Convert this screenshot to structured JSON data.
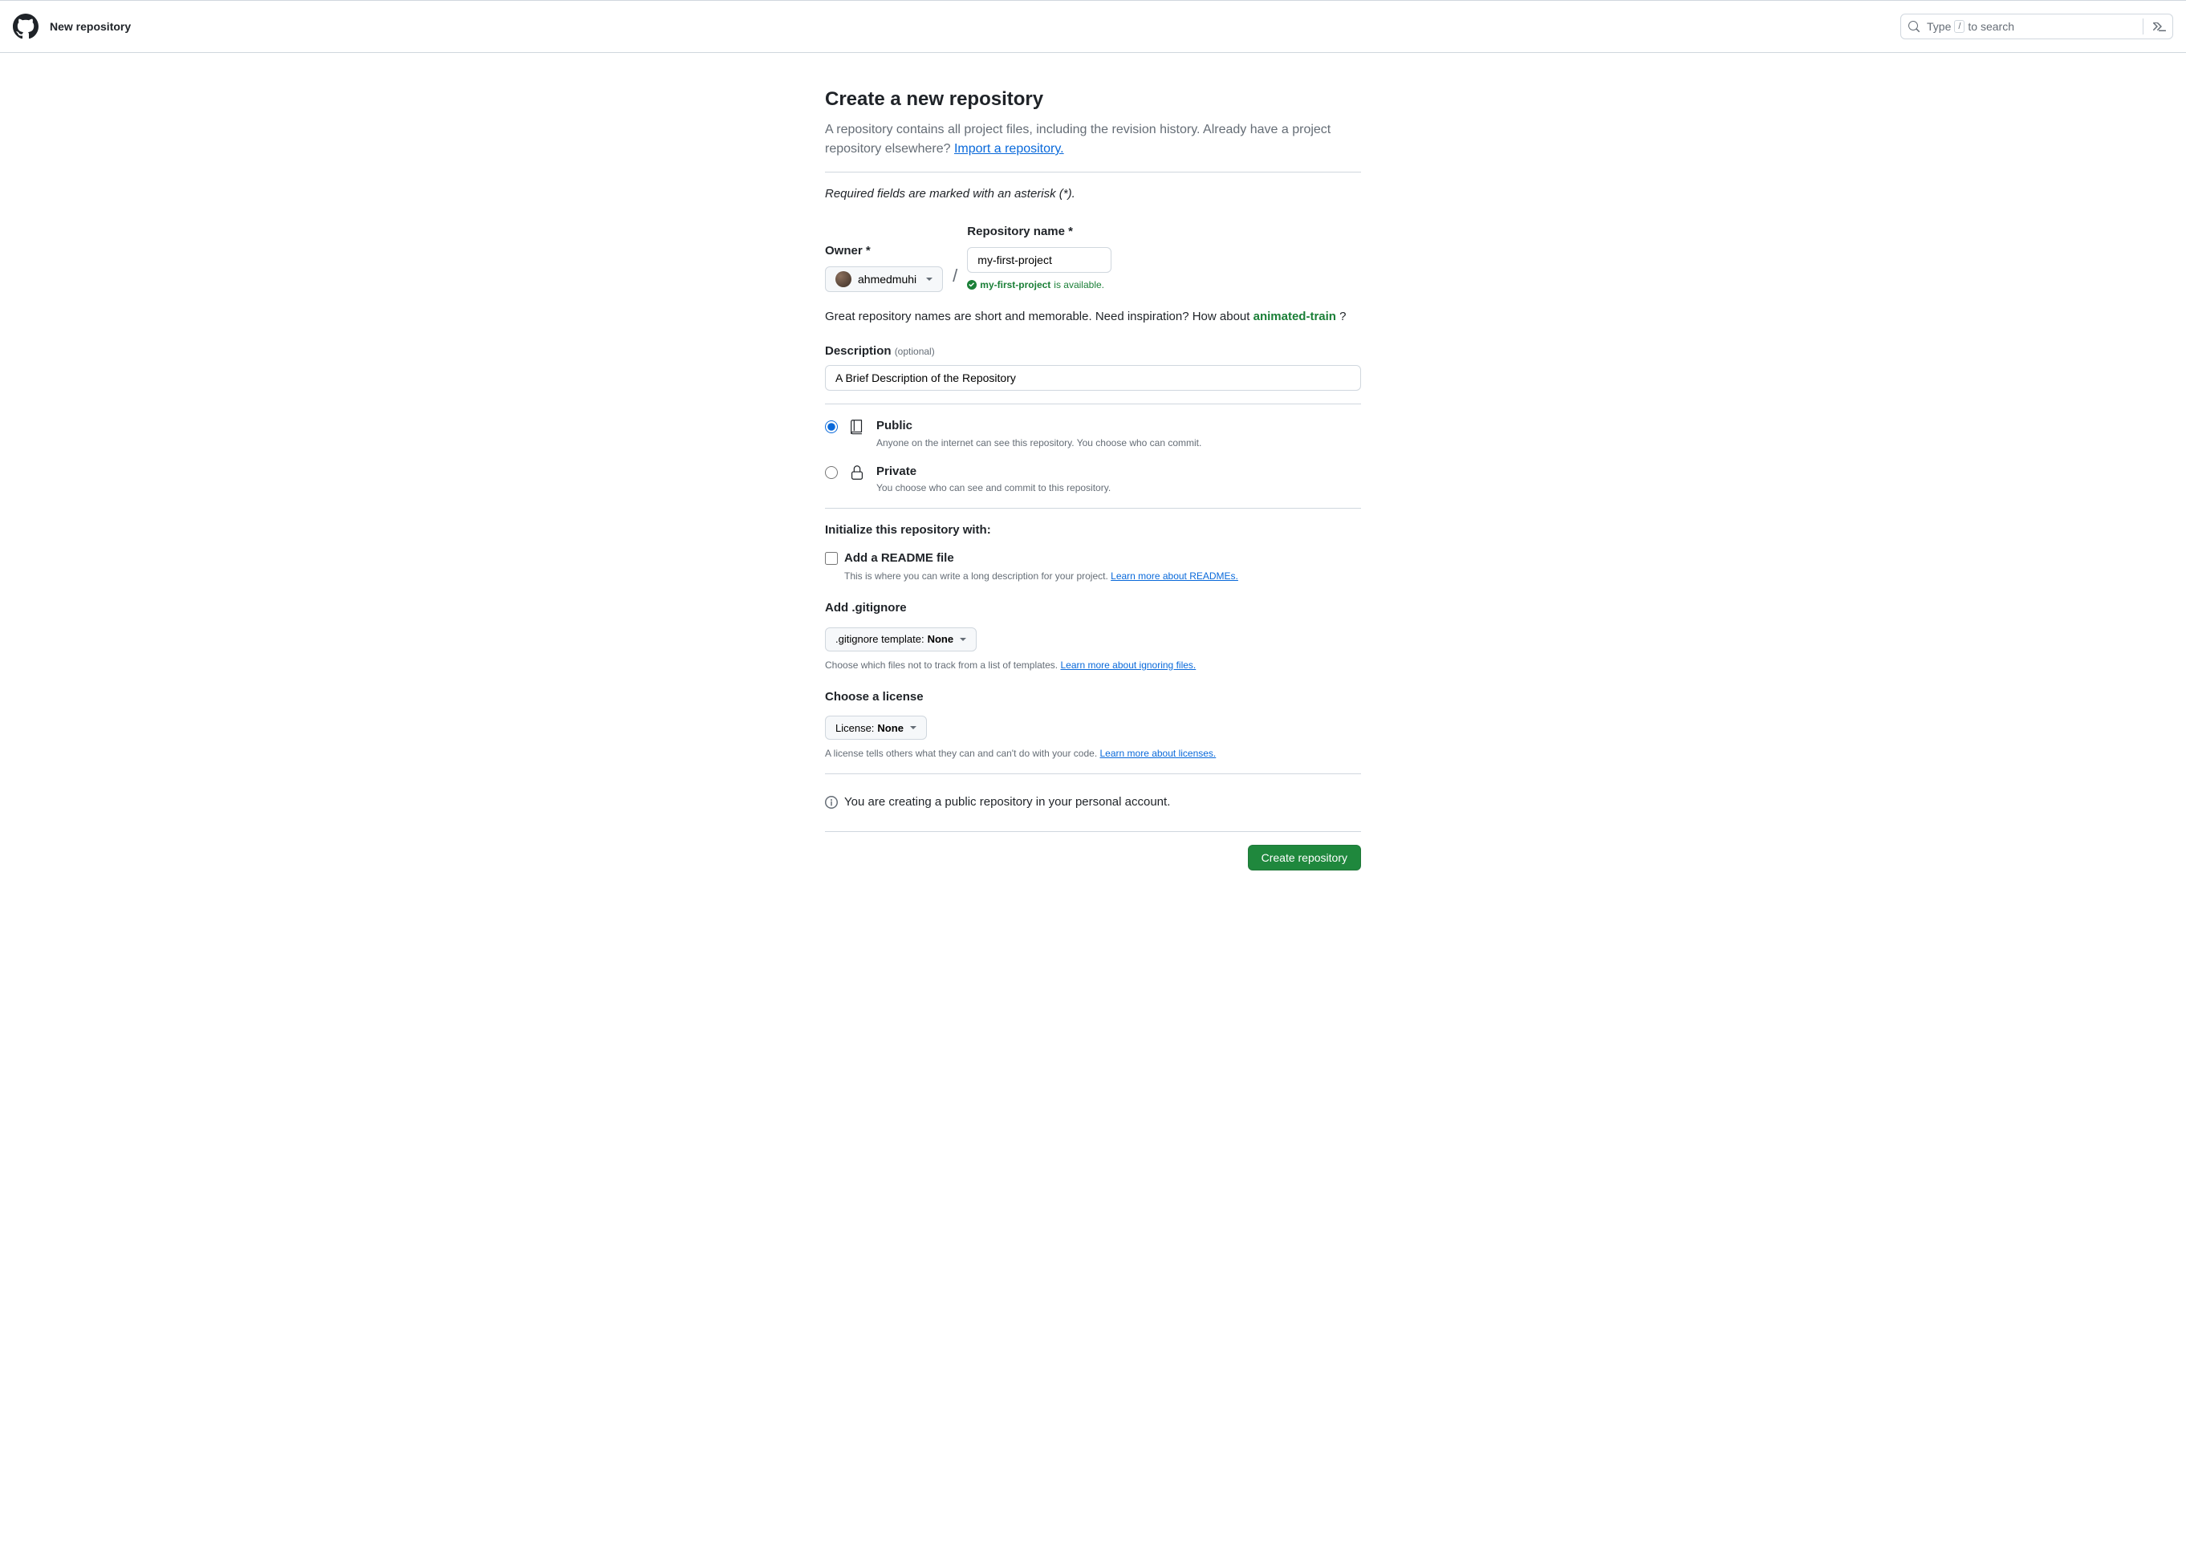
{
  "header": {
    "page_title": "New repository",
    "search_prefix": "Type",
    "search_kbd": "/",
    "search_suffix": "to search"
  },
  "main": {
    "heading": "Create a new repository",
    "intro": "A repository contains all project files, including the revision history. Already have a project repository elsewhere? ",
    "import_link": "Import a repository.",
    "required_note": "Required fields are marked with an asterisk (*).",
    "owner_label": "Owner *",
    "owner_value": "ahmedmuhi",
    "repo_label": "Repository name *",
    "repo_value": "my-first-project",
    "avail_name": "my-first-project",
    "avail_text": " is available.",
    "inspire_text": "Great repository names are short and memorable. Need inspiration? How about ",
    "inspire_suggest": "animated-train",
    "inspire_q": " ?",
    "desc_label": "Description ",
    "desc_optional": "(optional)",
    "desc_value": "A Brief Description of the Repository",
    "visibility": {
      "public": {
        "title": "Public",
        "desc": "Anyone on the internet can see this repository. You choose who can commit."
      },
      "private": {
        "title": "Private",
        "desc": "You choose who can see and commit to this repository."
      }
    },
    "init_heading": "Initialize this repository with:",
    "readme": {
      "title": "Add a README file",
      "desc": "This is where you can write a long description for your project. ",
      "link": "Learn more about READMEs."
    },
    "gitignore": {
      "heading": "Add .gitignore",
      "btn_prefix": ".gitignore template: ",
      "btn_value": "None",
      "help": "Choose which files not to track from a list of templates. ",
      "link": "Learn more about ignoring files."
    },
    "license": {
      "heading": "Choose a license",
      "btn_prefix": "License: ",
      "btn_value": "None",
      "help": "A license tells others what they can and can't do with your code. ",
      "link": "Learn more about licenses."
    },
    "info_text": "You are creating a public repository in your personal account.",
    "submit_label": "Create repository"
  }
}
